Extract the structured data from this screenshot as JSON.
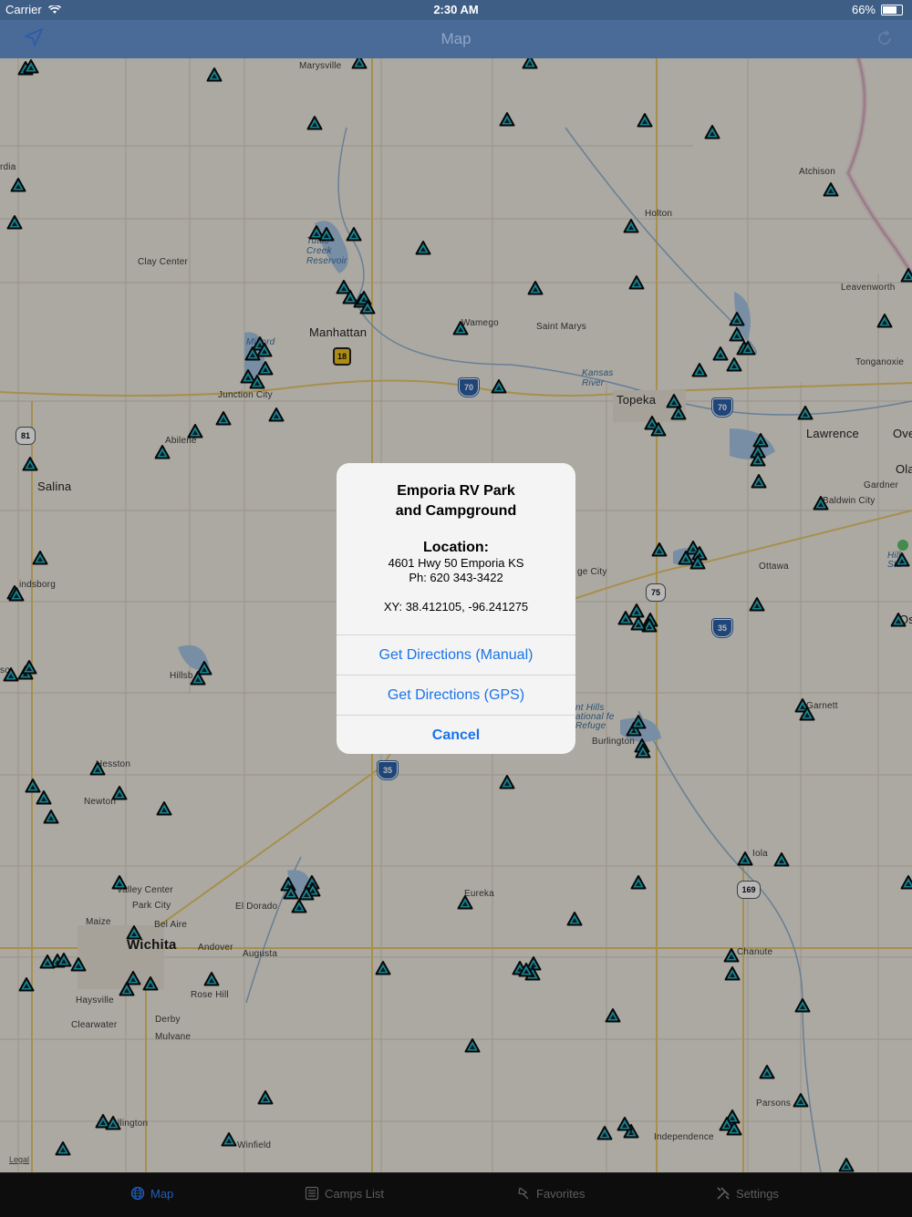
{
  "status_bar": {
    "carrier": "Carrier",
    "time": "2:30 AM",
    "battery": "66%",
    "battery_level": 0.66
  },
  "nav": {
    "title": "Map",
    "left_icon": "location-arrow-icon",
    "right_icon": "refresh-icon"
  },
  "map": {
    "legal": "Legal",
    "places": [
      {
        "name": "Marysville",
        "style": "normal"
      },
      {
        "name": "Clay Center",
        "style": "normal"
      },
      {
        "name": "Manhattan",
        "style": "big"
      },
      {
        "name": "Wamego",
        "style": "normal"
      },
      {
        "name": "Saint Marys",
        "style": "normal"
      },
      {
        "name": "Holton",
        "style": "normal"
      },
      {
        "name": "Atchison",
        "style": "normal"
      },
      {
        "name": "Leavenworth",
        "style": "normal"
      },
      {
        "name": "Tonganoxie",
        "style": "normal"
      },
      {
        "name": "Topeka",
        "style": "big"
      },
      {
        "name": "Lawrence",
        "style": "big"
      },
      {
        "name": "Ove",
        "style": "big"
      },
      {
        "name": "Ola",
        "style": "big"
      },
      {
        "name": "Gardner",
        "style": "normal"
      },
      {
        "name": "Baldwin City",
        "style": "normal"
      },
      {
        "name": "Junction City",
        "style": "normal"
      },
      {
        "name": "Abilene",
        "style": "normal"
      },
      {
        "name": "Salina",
        "style": "big"
      },
      {
        "name": "indsborg",
        "style": "normal"
      },
      {
        "name": "Ottawa",
        "style": "normal"
      },
      {
        "name": "Hillsb",
        "style": "normal"
      },
      {
        "name": "Garnett",
        "style": "normal"
      },
      {
        "name": "Burlington",
        "style": "normal"
      },
      {
        "name": "Hesston",
        "style": "normal"
      },
      {
        "name": "Newton",
        "style": "normal"
      },
      {
        "name": "Iola",
        "style": "normal"
      },
      {
        "name": "Valley Center",
        "style": "normal"
      },
      {
        "name": "Park City",
        "style": "normal"
      },
      {
        "name": "Bel Aire",
        "style": "normal"
      },
      {
        "name": "El Dorado",
        "style": "normal"
      },
      {
        "name": "Eureka",
        "style": "normal"
      },
      {
        "name": "Maize",
        "style": "normal"
      },
      {
        "name": "Wichita",
        "style": "xl"
      },
      {
        "name": "Andover",
        "style": "normal"
      },
      {
        "name": "Augusta",
        "style": "normal"
      },
      {
        "name": "Chanute",
        "style": "normal"
      },
      {
        "name": "Rose Hill",
        "style": "normal"
      },
      {
        "name": "Haysville",
        "style": "normal"
      },
      {
        "name": "Derby",
        "style": "normal"
      },
      {
        "name": "Clearwater",
        "style": "normal"
      },
      {
        "name": "Mulvane",
        "style": "normal"
      },
      {
        "name": "Parsons",
        "style": "normal"
      },
      {
        "name": "llington",
        "style": "normal"
      },
      {
        "name": "Winfield",
        "style": "normal"
      },
      {
        "name": "Independence",
        "style": "normal"
      },
      {
        "name": "Tuttle Creek Reservoir",
        "style": "water"
      },
      {
        "name": "Milford",
        "style": "water"
      },
      {
        "name": "Kansas River",
        "style": "water"
      },
      {
        "name": "ge City",
        "style": "normal"
      },
      {
        "name": "nt Hills ational fe Refuge",
        "style": "water"
      },
      {
        "name": "Hill Sta",
        "style": "water"
      },
      {
        "name": "rdia",
        "style": "normal"
      },
      {
        "name": "so",
        "style": "normal"
      },
      {
        "name": "Os",
        "style": "normal"
      }
    ],
    "shields": [
      {
        "label": "18",
        "kind": "ks"
      },
      {
        "label": "70",
        "kind": "i"
      },
      {
        "label": "70",
        "kind": "i"
      },
      {
        "label": "81",
        "kind": "us"
      },
      {
        "label": "75",
        "kind": "us"
      },
      {
        "label": "35",
        "kind": "i"
      },
      {
        "label": "35",
        "kind": "i"
      },
      {
        "label": "169",
        "kind": "us"
      }
    ]
  },
  "alert": {
    "title_line1": "Emporia RV Park",
    "title_line2": "and Campground",
    "location_heading": "Location:",
    "address": "4601 Hwy 50 Emporia KS",
    "phone": "Ph: 620 343-3422",
    "xy": "XY: 38.412105, -96.241275",
    "buttons": {
      "manual": "Get Directions (Manual)",
      "gps": "Get Directions (GPS)",
      "cancel": "Cancel"
    }
  },
  "tabs": [
    {
      "label": "Map",
      "icon": "globe-icon",
      "active": true
    },
    {
      "label": "Camps List",
      "icon": "list-icon",
      "active": false
    },
    {
      "label": "Favorites",
      "icon": "pin-icon",
      "active": false
    },
    {
      "label": "Settings",
      "icon": "tools-icon",
      "active": false
    }
  ],
  "colors": {
    "nav": "#4a6b97",
    "accent": "#1a74e8",
    "camp_fill": "#1fb4c9",
    "tab_active": "#1f5fb8"
  }
}
